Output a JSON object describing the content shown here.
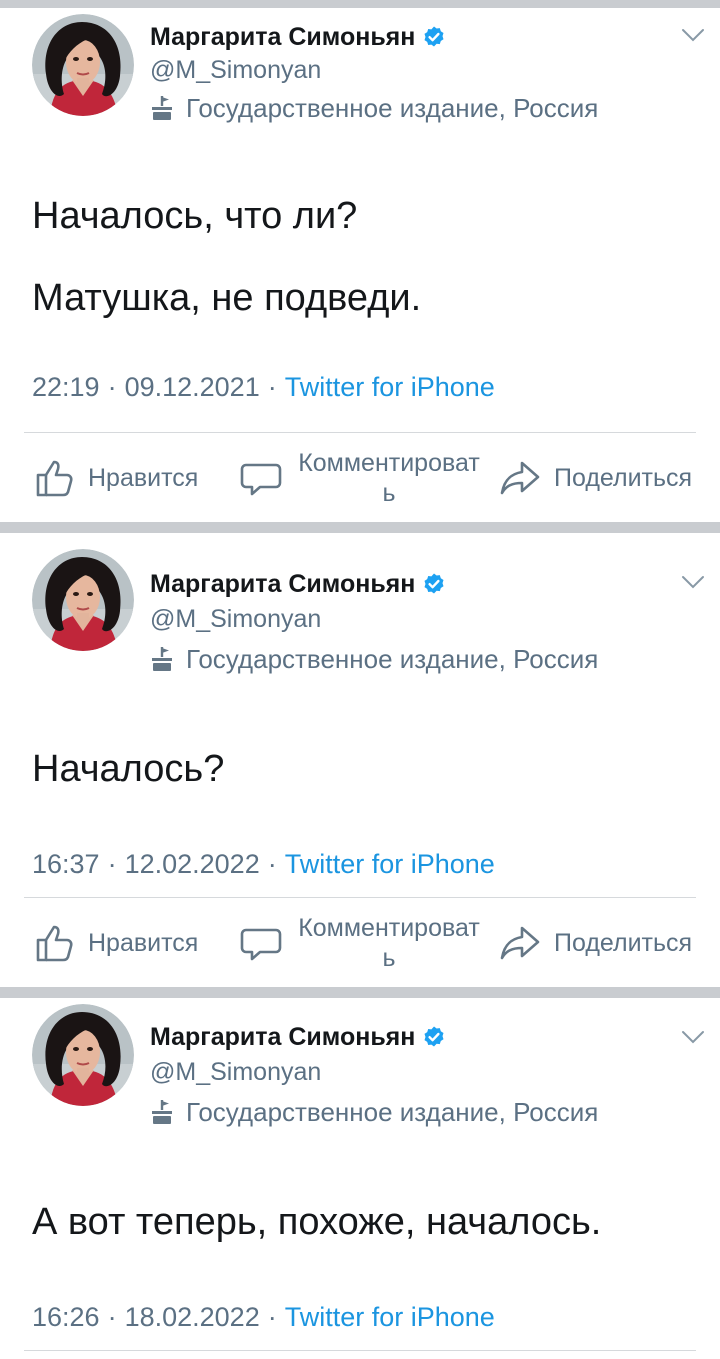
{
  "colors": {
    "separator": "#c9ccd0",
    "name": "#14171a",
    "muted": "#5b7083",
    "link": "#1b95e0",
    "verified": "#1da1f2"
  },
  "tweets": [
    {
      "author": {
        "name": "Маргарита Симоньян",
        "handle": "@M_Simonyan",
        "label": "Государственное издание, Россия"
      },
      "lines": [
        "Началось, что ли?",
        "Матушка, не подведи."
      ],
      "time": "22:19",
      "date": "09.12.2021",
      "source": "Twitter for iPhone",
      "actions": {
        "like": "Нравится",
        "comment": "Комментировать",
        "share": "Поделиться"
      }
    },
    {
      "author": {
        "name": "Маргарита Симоньян",
        "handle": "@M_Simonyan",
        "label": "Государственное издание, Россия"
      },
      "lines": [
        "Началось?"
      ],
      "time": "16:37",
      "date": "12.02.2022",
      "source": "Twitter for iPhone",
      "actions": {
        "like": "Нравится",
        "comment": "Комментировать",
        "share": "Поделиться"
      }
    },
    {
      "author": {
        "name": "Маргарита Симоньян",
        "handle": "@M_Simonyan",
        "label": "Государственное издание, Россия"
      },
      "lines": [
        "А вот теперь, похоже, началось."
      ],
      "time": "16:26",
      "date": "18.02.2022",
      "source": "Twitter for iPhone"
    }
  ],
  "icons": {
    "avatar": "avatar-photo",
    "verified": "verified-badge-icon",
    "label": "government-building-icon",
    "menu": "chevron-down-icon",
    "like": "thumbs-up-icon",
    "comment": "speech-bubble-icon",
    "share": "share-arrow-icon"
  }
}
